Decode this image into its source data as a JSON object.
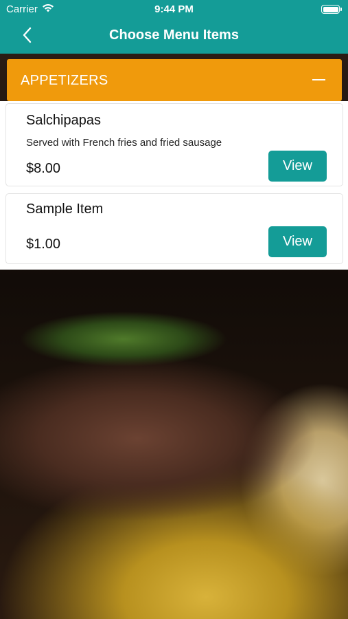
{
  "status_bar": {
    "carrier": "Carrier",
    "time": "9:44 PM",
    "battery_level": 1.0
  },
  "nav": {
    "title": "Choose Menu Items",
    "back_icon": "chevron-left-icon"
  },
  "section": {
    "title": "APPETIZERS",
    "toggle_icon": "minus-icon"
  },
  "items": [
    {
      "name": "Salchipapas",
      "description": "Served with French fries and fried sausage",
      "price": "$8.00",
      "button_label": "View"
    },
    {
      "name": "Sample Item",
      "description": "",
      "price": "$1.00",
      "button_label": "View"
    }
  ],
  "colors": {
    "primary": "#149c97",
    "section_header": "#f09a0c",
    "card_bg": "#ffffff"
  }
}
